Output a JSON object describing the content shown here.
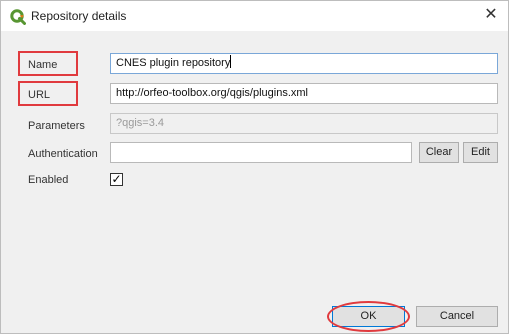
{
  "window": {
    "title": "Repository details",
    "close_glyph": "✕"
  },
  "form": {
    "name_label": "Name",
    "name_value": "CNES plugin repository",
    "url_label": "URL",
    "url_value": "http://orfeo-toolbox.org/qgis/plugins.xml",
    "parameters_label": "Parameters",
    "parameters_placeholder": "?qgis=3.4",
    "authentication_label": "Authentication",
    "authentication_value": "",
    "clear_label": "Clear",
    "edit_label": "Edit",
    "enabled_label": "Enabled",
    "enabled_checked": true,
    "check_glyph": "✓"
  },
  "buttons": {
    "ok_label": "OK",
    "cancel_label": "Cancel"
  },
  "icons": {
    "app": "qgis-icon",
    "close": "close-icon",
    "check": "checkmark-icon"
  },
  "colors": {
    "annotation_red": "#e03a3e",
    "focus_blue": "#0078d7",
    "qgis_green": "#589632",
    "qgis_yellow": "#ee7913"
  }
}
